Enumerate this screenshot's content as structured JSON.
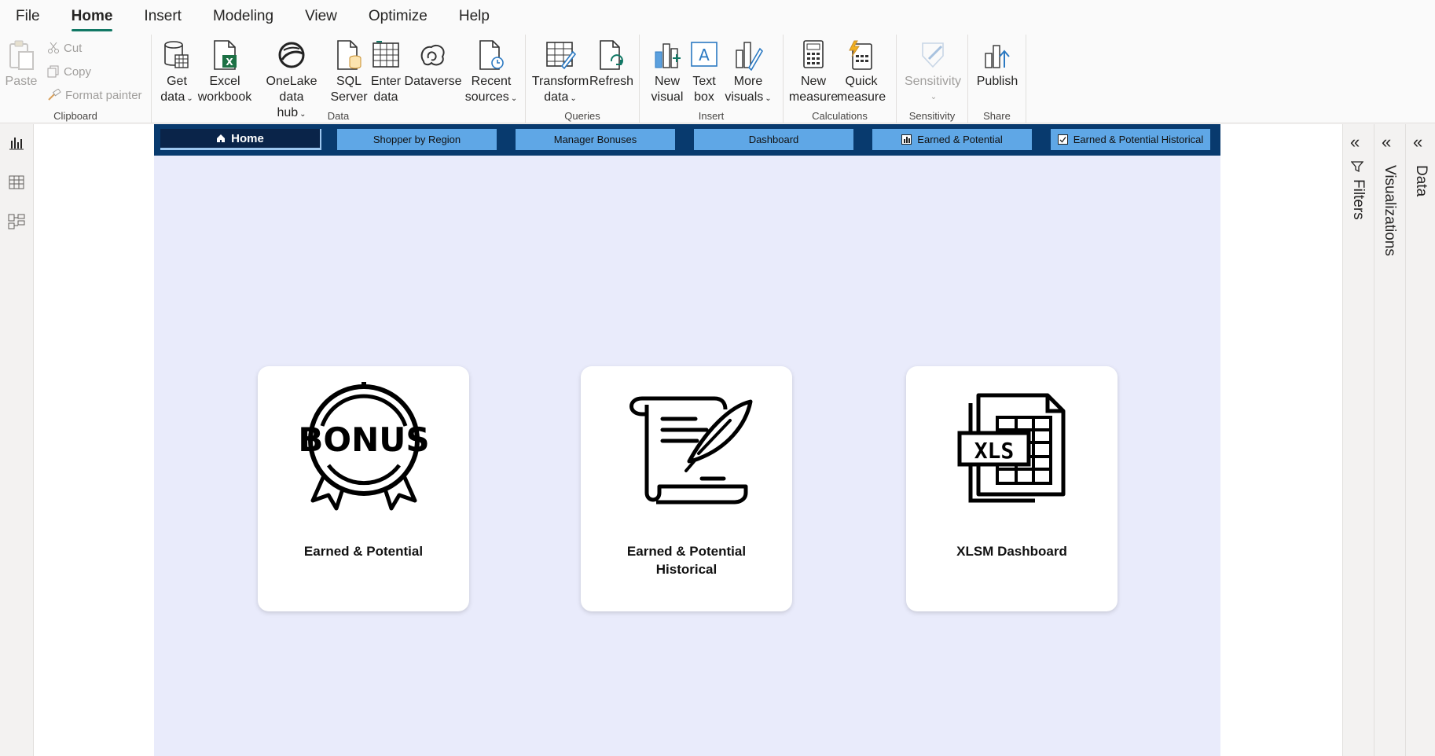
{
  "menu": [
    "File",
    "Home",
    "Insert",
    "Modeling",
    "View",
    "Optimize",
    "Help"
  ],
  "ribbon": {
    "clipboard": {
      "paste": "Paste",
      "cut": "Cut",
      "copy": "Copy",
      "format_painter": "Format painter",
      "label": "Clipboard"
    },
    "data": {
      "get_data": [
        "Get",
        "data"
      ],
      "excel": [
        "Excel",
        "workbook"
      ],
      "onelake": [
        "OneLake data",
        "hub"
      ],
      "sql": [
        "SQL",
        "Server"
      ],
      "enter": [
        "Enter",
        "data"
      ],
      "dataverse": "Dataverse",
      "recent": [
        "Recent",
        "sources"
      ],
      "label": "Data"
    },
    "queries": {
      "transform": [
        "Transform",
        "data"
      ],
      "refresh": "Refresh",
      "label": "Queries"
    },
    "insert": {
      "new_visual": [
        "New",
        "visual"
      ],
      "text_box": [
        "Text",
        "box"
      ],
      "more_visuals": [
        "More",
        "visuals"
      ],
      "label": "Insert"
    },
    "calculations": {
      "new_measure": [
        "New",
        "measure"
      ],
      "quick_measure": [
        "Quick",
        "measure"
      ],
      "label": "Calculations"
    },
    "sensitivity": {
      "button": "Sensitivity",
      "label": "Sensitivity"
    },
    "share": {
      "publish": "Publish",
      "label": "Share"
    }
  },
  "nav": {
    "home": "Home",
    "shopper": "Shopper by Region",
    "manager": "Manager Bonuses",
    "dashboard": "Dashboard",
    "earned": "Earned & Potential",
    "historical": "Earned & Potential Historical"
  },
  "cards": [
    {
      "title": "Earned & Potential",
      "icon": "bonus-badge-icon",
      "badge_text": "BONUS"
    },
    {
      "title": "Earned & Potential Historical",
      "icon": "scroll-quill-icon"
    },
    {
      "title": "XLSM Dashboard",
      "icon": "xls-file-icon",
      "badge_text": "XLS"
    }
  ],
  "panes": {
    "filters": "Filters",
    "visualizations": "Visualizations",
    "data": "Data"
  },
  "colors": {
    "accent": "#117865",
    "nav_bar": "#083a6e",
    "nav_button": "#5fa7e6",
    "nav_home": "#0a2449",
    "page_bg": "#e9ebfb"
  }
}
